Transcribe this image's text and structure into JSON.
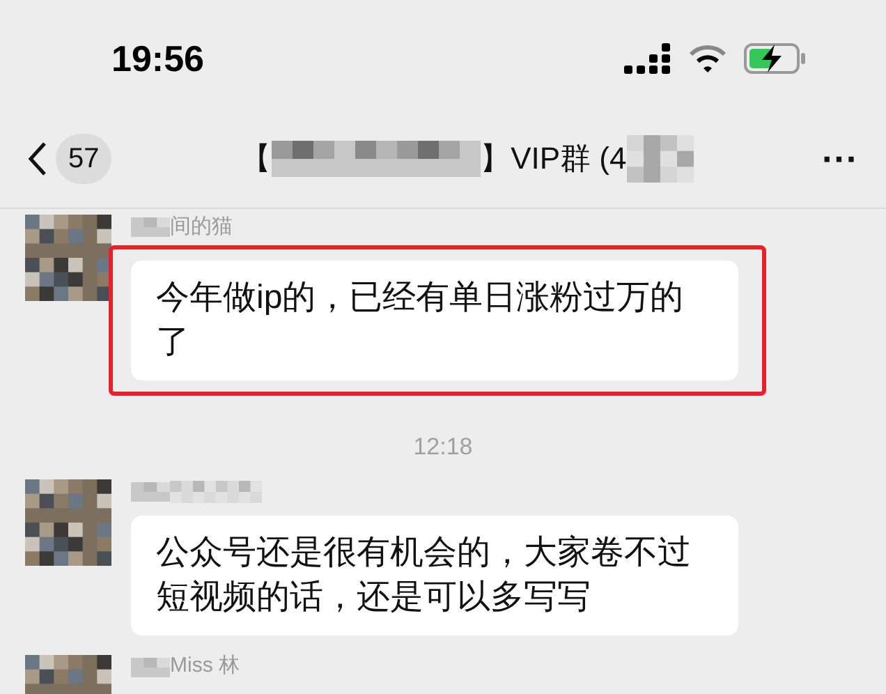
{
  "status_bar": {
    "time": "19:56",
    "battery": {
      "charging": true
    }
  },
  "header": {
    "back_count": "57",
    "title_start": "【",
    "title_end": "】VIP群 (4",
    "more": "···"
  },
  "messages": [
    {
      "kind": "message",
      "sender": "间的猫",
      "text": "今年做ip的，已经有单日涨粉过万的了",
      "highlighted": true
    },
    {
      "kind": "time",
      "text": "12:18"
    },
    {
      "kind": "message",
      "text": "公众号还是很有机会的，大家卷不过短视频的话，还是可以多写写",
      "highlighted": false
    },
    {
      "kind": "message",
      "sender": "Miss 林"
    }
  ]
}
